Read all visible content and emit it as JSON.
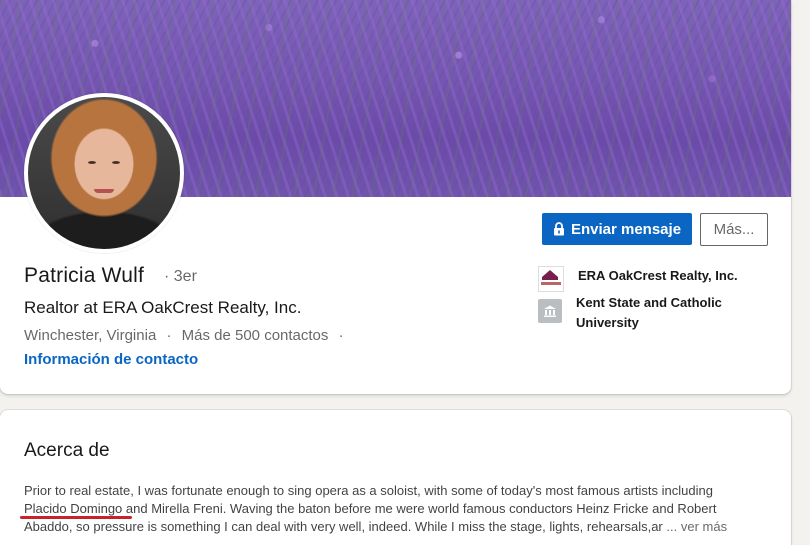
{
  "profile": {
    "name": "Patricia Wulf",
    "degree": "· 3er",
    "headline": "Realtor at ERA OakCrest Realty, Inc.",
    "location": "Winchester, Virginia",
    "connections": "Más de 500 contactos",
    "separator": "·",
    "contact_info_label": "Información de contacto"
  },
  "actions": {
    "message_label": "Enviar mensaje",
    "more_label": "Más..."
  },
  "organizations": {
    "company": "ERA OakCrest Realty, Inc.",
    "school_line1": "Kent State and Catholic",
    "school_line2": "University"
  },
  "about": {
    "title": "Acerca de",
    "line1": "Prior to real estate, I was fortunate enough to sing opera as a soloist, with some of today's most famous artists including",
    "line2": "Placido Domingo and Mirella Freni. Waving the baton before me were world famous conductors Heinz Fricke and Robert",
    "line3": "Abaddo, so pressure is something I can deal with very well, indeed. While I miss the stage, lights, rehearsals,ar",
    "see_more_label": "... ver más"
  },
  "colors": {
    "accent": "#0a66c2",
    "annotation": "#c6242b"
  }
}
